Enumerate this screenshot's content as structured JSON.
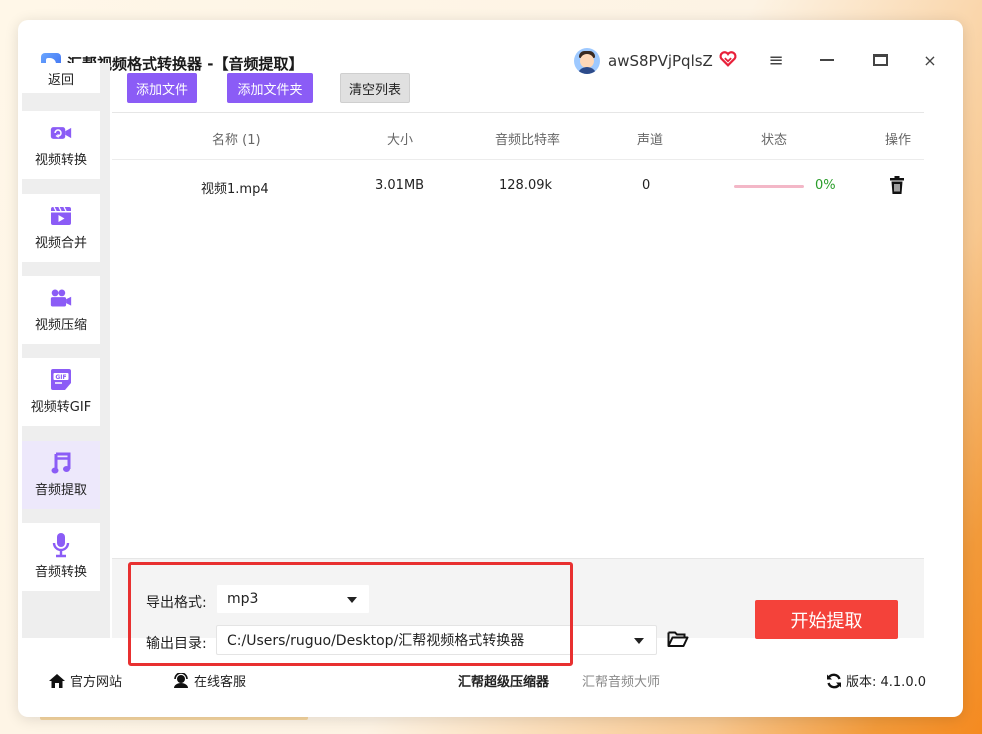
{
  "app": {
    "title": "汇帮视频格式转换器 -【音频提取】",
    "username": "awS8PVjPqlsZ",
    "window_controls": {
      "menu": "≡",
      "minimize": "—",
      "close": "×"
    }
  },
  "sidebar": {
    "back_label": "返回",
    "items": [
      {
        "label": "视频转换",
        "icon": "video-convert-icon",
        "active": false
      },
      {
        "label": "视频合并",
        "icon": "video-merge-icon",
        "active": false
      },
      {
        "label": "视频压缩",
        "icon": "video-compress-icon",
        "active": false
      },
      {
        "label": "视频转GIF",
        "icon": "gif-icon",
        "active": false
      },
      {
        "label": "音频提取",
        "icon": "music-note-icon",
        "active": true
      },
      {
        "label": "音频转换",
        "icon": "microphone-icon",
        "active": false
      }
    ],
    "icon_badge_gif": "GIF"
  },
  "toolbar": {
    "add_file": "添加文件",
    "add_folder": "添加文件夹",
    "clear_list": "清空列表"
  },
  "table": {
    "headers": [
      "名称 (1)",
      "大小",
      "音频比特率",
      "声道",
      "状态",
      "操作"
    ],
    "rows": [
      {
        "name": "视频1.mp4",
        "size": "3.01MB",
        "bitrate": "128.09k",
        "channels": "0",
        "progress": 0,
        "progress_text": "0%"
      }
    ]
  },
  "settings": {
    "format_label": "导出格式:",
    "format_value": "mp3",
    "dir_label": "输出目录:",
    "dir_value": "C:/Users/ruguo/Desktop/汇帮视频格式转换器",
    "start_button": "开始提取"
  },
  "footer": {
    "website": "官方网站",
    "support": "在线客服",
    "link1": "汇帮超级压缩器",
    "link2": "汇帮音频大师",
    "version": "版本: 4.1.0.0"
  },
  "colors": {
    "accent_purple": "#8b5cf6",
    "start_red": "#f4423a",
    "highlight_red": "#e83030",
    "progress_green": "#2a9d2a"
  }
}
